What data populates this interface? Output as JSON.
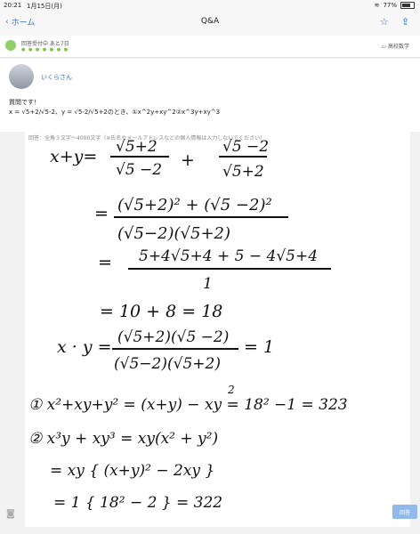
{
  "status_bar": {
    "time": "20:21",
    "date": "1月15日(月)",
    "battery": "77%"
  },
  "navbar": {
    "back_label": "ホーム",
    "title": "Q&A"
  },
  "question_status": {
    "text": "回答受付中 あと7日",
    "category": "高校数学"
  },
  "question": {
    "username": "いくらさん",
    "line1": "質問です！",
    "line2": "x = √5+2/√5-2、y = √5-2/√5+2のとき、①x^2y+xy^2②x^3y+xy^3"
  },
  "answer": {
    "placeholder": "回答：全角３文字〜4000文字（※氏名やメールアドレスなどの個人情報は入力しないでください）",
    "handwriting": {
      "l1_lhs": "x+y=",
      "l1_n1": "√5+2",
      "l1_d1": "√5 −2",
      "l1_plus": "+",
      "l1_n2": "√5 −2",
      "l1_d2": "√5+2",
      "l2_eq": "=",
      "l2_num": "(√5+2)² + (√5 −2)²",
      "l2_den": "(√5−2)(√5+2)",
      "l3_eq": "=",
      "l3_num": "5+4√5+4 + 5 − 4√5+4",
      "l3_den": "1",
      "l4": "= 10 + 8 = 18",
      "l5_lhs": "x · y =",
      "l5_num": "(√5+2)(√5 −2)",
      "l5_den": "(√5−2)(√5+2)",
      "l5_rhs": "= 1",
      "l6": "①  x²+xy+y² = (x+y) − xy = 18² −1 = 323",
      "l6_sup": "2",
      "l7": "②  x³y + xy³ = xy(x² + y²)",
      "l8": "= xy { (x+y)² − 2xy }",
      "l9": "= 1 { 18² − 2 } = 322"
    },
    "submit_label": "回答"
  },
  "icons": {
    "back": "chevron-left-icon",
    "favorite": "star-icon",
    "share": "share-icon",
    "category": "folder-icon",
    "camera": "camera-icon"
  }
}
